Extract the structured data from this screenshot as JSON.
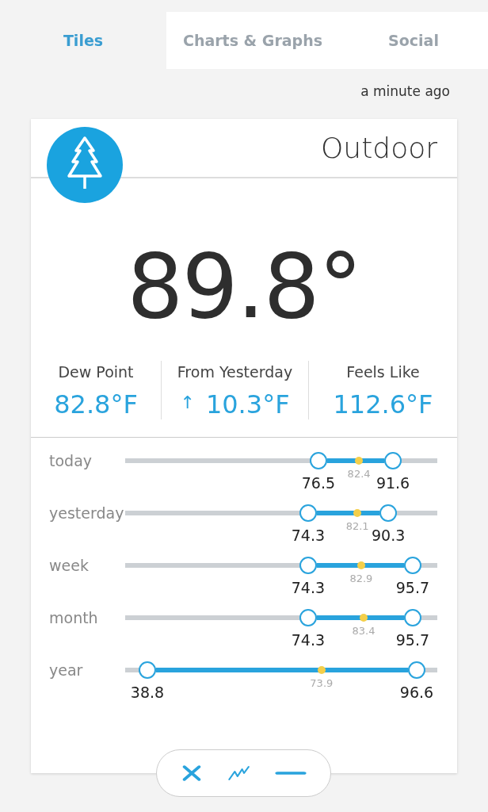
{
  "tabs": [
    {
      "label": "Tiles",
      "selected": true
    },
    {
      "label": "Charts & Graphs",
      "selected": false
    },
    {
      "label": "Social",
      "selected": false
    }
  ],
  "updated": "a minute ago",
  "tile": {
    "title": "Outdoor",
    "temperature": "89.8°",
    "stats": [
      {
        "label": "Dew Point",
        "value": "82.8°F"
      },
      {
        "label": "From Yesterday",
        "arrow": "↑",
        "value": "10.3°F"
      },
      {
        "label": "Feels Like",
        "value": "112.6°F"
      }
    ],
    "ranges": [
      {
        "label": "today",
        "low": {
          "level": 0.619,
          "reading": "76.5"
        },
        "average": {
          "level": 0.749,
          "reading": "82.4"
        },
        "high": {
          "level": 0.858,
          "reading": "91.6"
        }
      },
      {
        "label": "yesterday",
        "low": {
          "level": 0.586,
          "reading": "74.3"
        },
        "average": {
          "level": 0.744,
          "reading": "82.1"
        },
        "high": {
          "level": 0.843,
          "reading": "90.3"
        }
      },
      {
        "label": "week",
        "low": {
          "level": 0.586,
          "reading": "74.3"
        },
        "average": {
          "level": 0.756,
          "reading": "82.9"
        },
        "high": {
          "level": 0.921,
          "reading": "95.7"
        }
      },
      {
        "label": "month",
        "low": {
          "level": 0.586,
          "reading": "74.3"
        },
        "average": {
          "level": 0.764,
          "reading": "83.4"
        },
        "high": {
          "level": 0.921,
          "reading": "95.7"
        }
      },
      {
        "label": "year",
        "low": {
          "level": 0.071,
          "reading": "38.8"
        },
        "average": {
          "level": 0.629,
          "reading": "73.9"
        },
        "high": {
          "level": 0.934,
          "reading": "96.6"
        }
      }
    ]
  },
  "toolbar": [
    {
      "kind": "close"
    },
    {
      "kind": "chart"
    },
    {
      "kind": "minimize"
    }
  ]
}
